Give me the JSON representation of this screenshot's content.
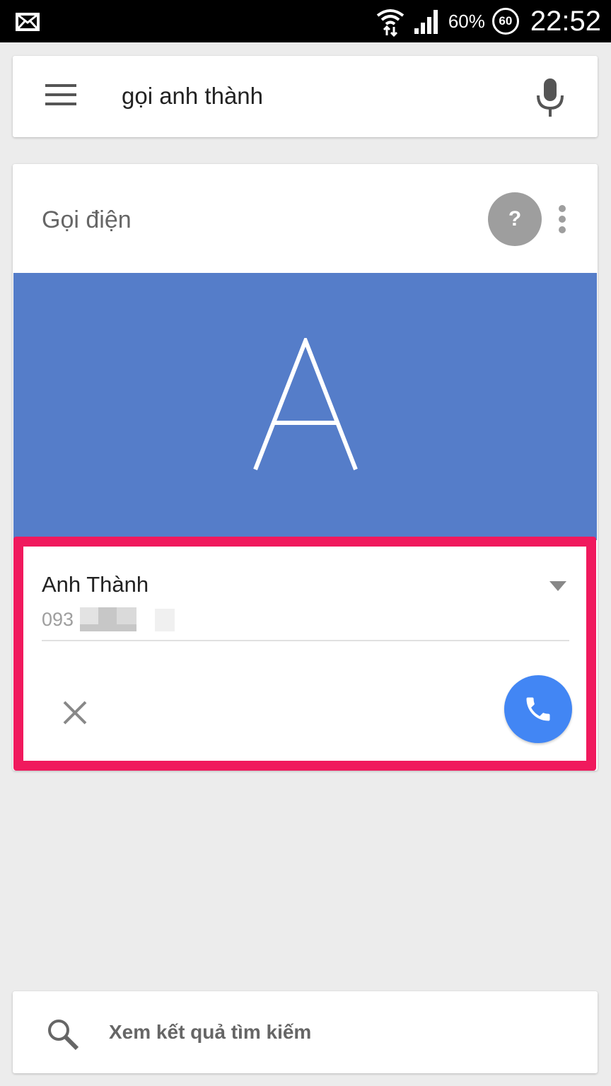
{
  "status_bar": {
    "battery": "60%",
    "badge": "60",
    "time": "22:52"
  },
  "search": {
    "query": "gọi anh thành"
  },
  "card": {
    "title": "Gọi điện",
    "help_symbol": "?",
    "avatar_initial": "A",
    "banner_color": "#557dc9"
  },
  "contact": {
    "name": "Anh Thành",
    "phone_prefix": "093"
  },
  "footer": {
    "results_label": "Xem kết quả tìm kiếm"
  },
  "colors": {
    "highlight": "#f0195d",
    "call_button": "#4286f4"
  }
}
